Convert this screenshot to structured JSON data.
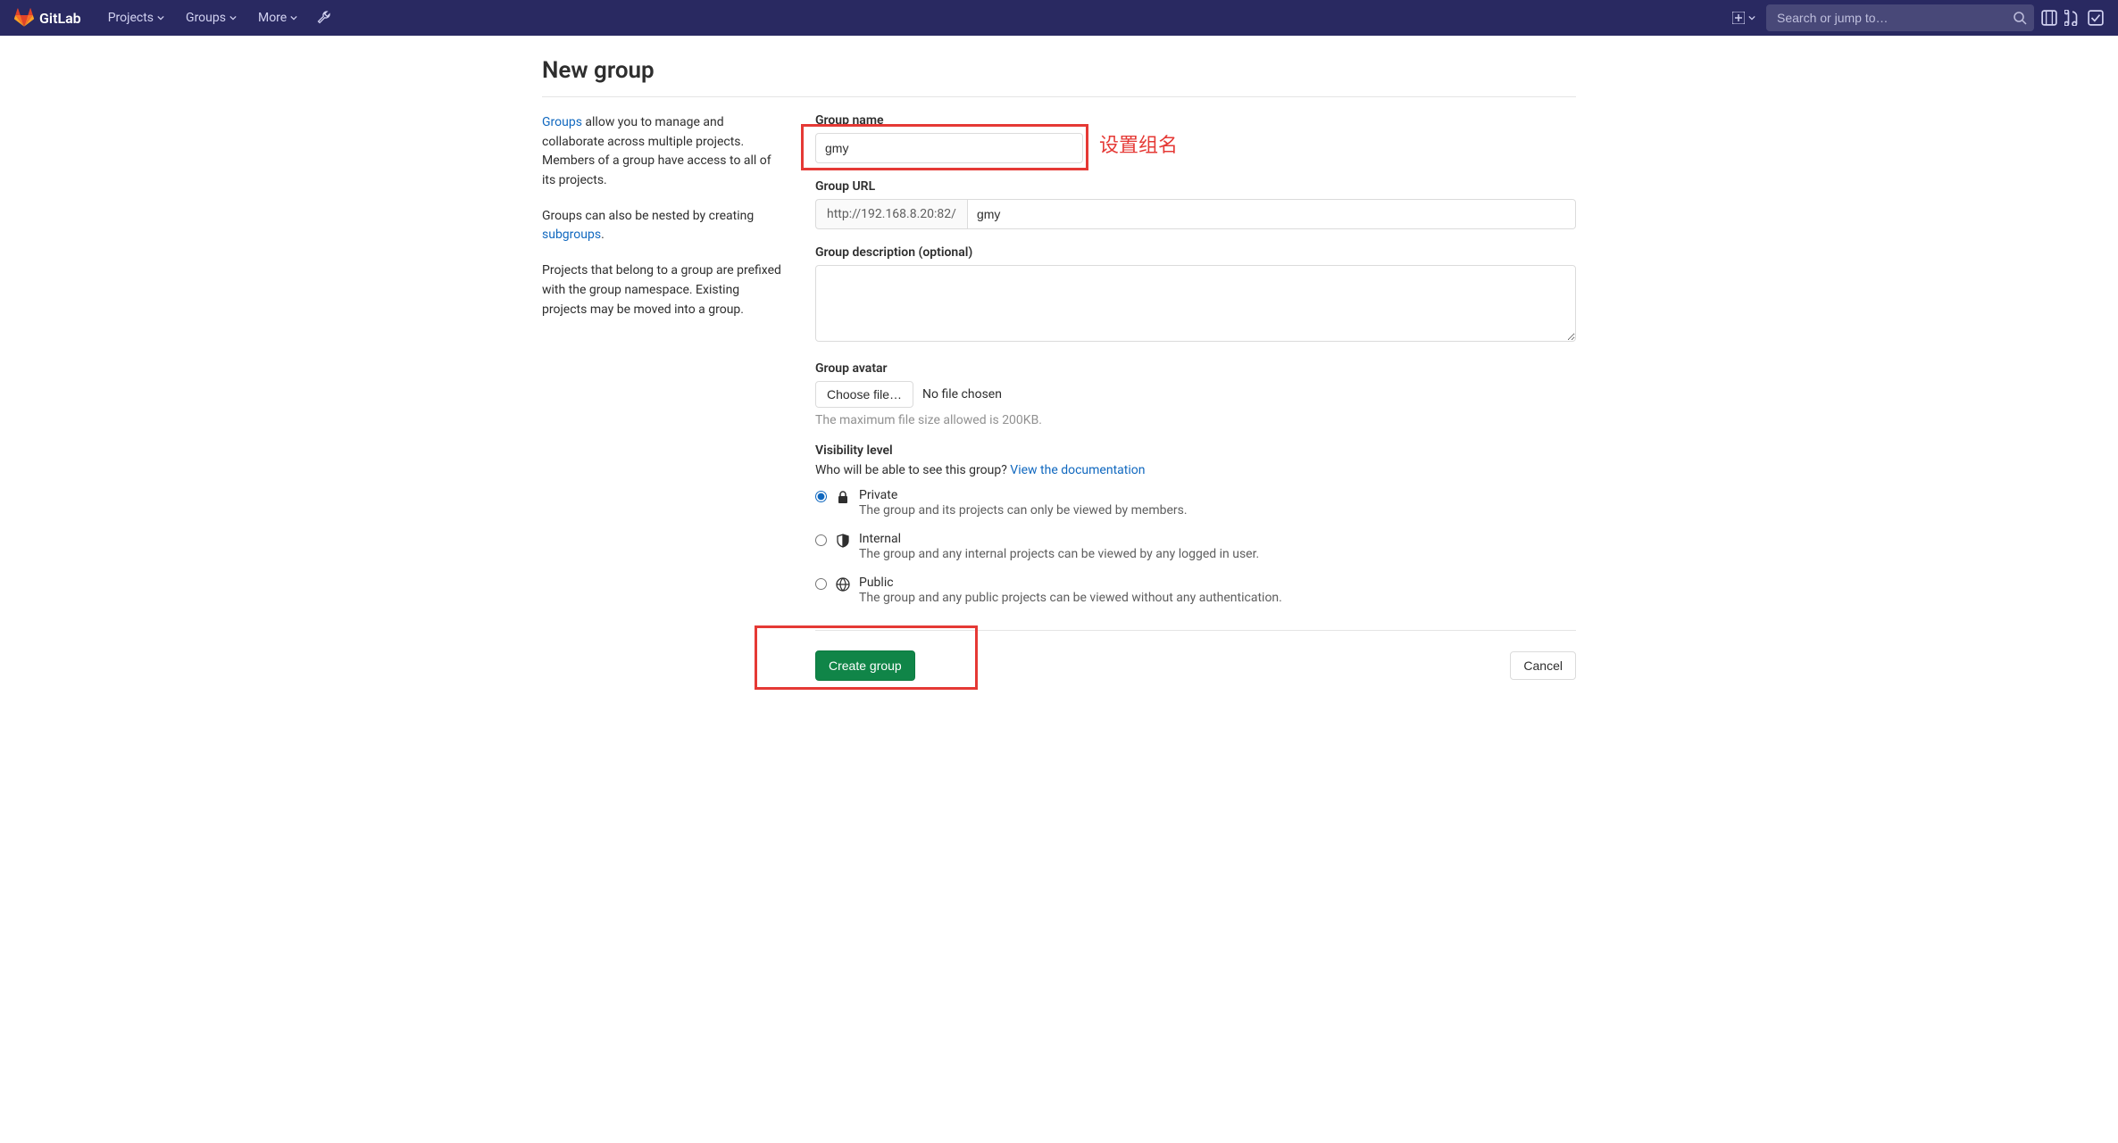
{
  "navbar": {
    "brand": "GitLab",
    "items": [
      "Projects",
      "Groups",
      "More"
    ],
    "search_placeholder": "Search or jump to…"
  },
  "page": {
    "title": "New group"
  },
  "info": {
    "p1_link": "Groups",
    "p1_rest": " allow you to manage and collaborate across multiple projects. Members of a group have access to all of its projects.",
    "p2_pre": "Groups can also be nested by creating ",
    "p2_link": "subgroups",
    "p2_post": ".",
    "p3": "Projects that belong to a group are prefixed with the group namespace. Existing projects may be moved into a group."
  },
  "form": {
    "group_name_label": "Group name",
    "group_name_value": "gmy",
    "annotation_name": "设置组名",
    "url_label": "Group URL",
    "url_prefix": "http://192.168.8.20:82/",
    "url_value": "gmy",
    "desc_label": "Group description (optional)",
    "avatar_label": "Group avatar",
    "choose_file": "Choose file…",
    "no_file": "No file chosen",
    "file_hint": "The maximum file size allowed is 200KB.",
    "visibility_label": "Visibility level",
    "visibility_question": "Who will be able to see this group? ",
    "visibility_doc_link": "View the documentation",
    "vis": [
      {
        "title": "Private",
        "desc": "The group and its projects can only be viewed by members."
      },
      {
        "title": "Internal",
        "desc": "The group and any internal projects can be viewed by any logged in user."
      },
      {
        "title": "Public",
        "desc": "The group and any public projects can be viewed without any authentication."
      }
    ],
    "create_btn": "Create group",
    "cancel_btn": "Cancel"
  }
}
